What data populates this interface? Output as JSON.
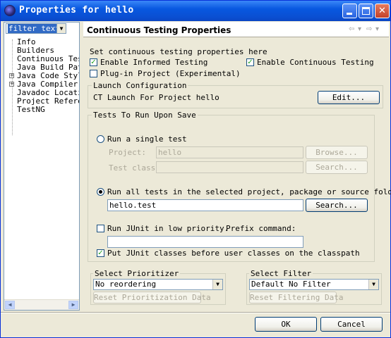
{
  "window": {
    "title": "Properties for hello"
  },
  "filter": {
    "text": "filter text"
  },
  "tree": [
    {
      "label": "Info",
      "expandable": false
    },
    {
      "label": "Builders",
      "expandable": false
    },
    {
      "label": "Continuous Testi",
      "expandable": false
    },
    {
      "label": "Java Build Path",
      "expandable": false
    },
    {
      "label": "Java Code Style",
      "expandable": true
    },
    {
      "label": "Java Compiler",
      "expandable": true
    },
    {
      "label": "Javadoc Location",
      "expandable": false
    },
    {
      "label": "Project Referenc",
      "expandable": false
    },
    {
      "label": "TestNG",
      "expandable": false
    }
  ],
  "page": {
    "title": "Continuous Testing Properties",
    "intro": "Set continuous testing properties here"
  },
  "options": {
    "informed": {
      "label": "Enable Informed Testing",
      "checked": true
    },
    "continuous": {
      "label": "Enable Continuous Testing",
      "checked": true
    },
    "plugin": {
      "label": "Plug-in Project (Experimental)",
      "checked": false
    }
  },
  "launch": {
    "group": "Launch Configuration",
    "text": "CT Launch For Project hello",
    "edit": "Edit..."
  },
  "tests": {
    "group": "Tests To Run Upon Save",
    "single": {
      "label": "Run a single test",
      "selected": false
    },
    "project_label": "Project:",
    "project_value": "hello",
    "browse": "Browse...",
    "class_label": "Test class:",
    "search_disabled": "Search...",
    "all": {
      "label": "Run all tests in the selected project, package or source folder:",
      "selected": true
    },
    "all_value": "hello.test",
    "search": "Search...",
    "lowpri": {
      "label": "Run JUnit in low priority.",
      "checked": false
    },
    "prefix_label": "Prefix command:",
    "prefix_value": "",
    "put_first": {
      "label": "Put JUnit classes before user classes on the classpath",
      "checked": true
    }
  },
  "prioritizer": {
    "group": "Select Prioritizer",
    "value": "No reordering",
    "reset": "Reset Prioritization Data"
  },
  "filter_group": {
    "group": "Select Filter",
    "value": "Default No Filter",
    "reset": "Reset Filtering Data"
  },
  "buttons": {
    "ok": "OK",
    "cancel": "Cancel"
  },
  "colors": {
    "titlebar": "#0a54e0",
    "face": "#ece9d8",
    "selection": "#316ac5"
  }
}
